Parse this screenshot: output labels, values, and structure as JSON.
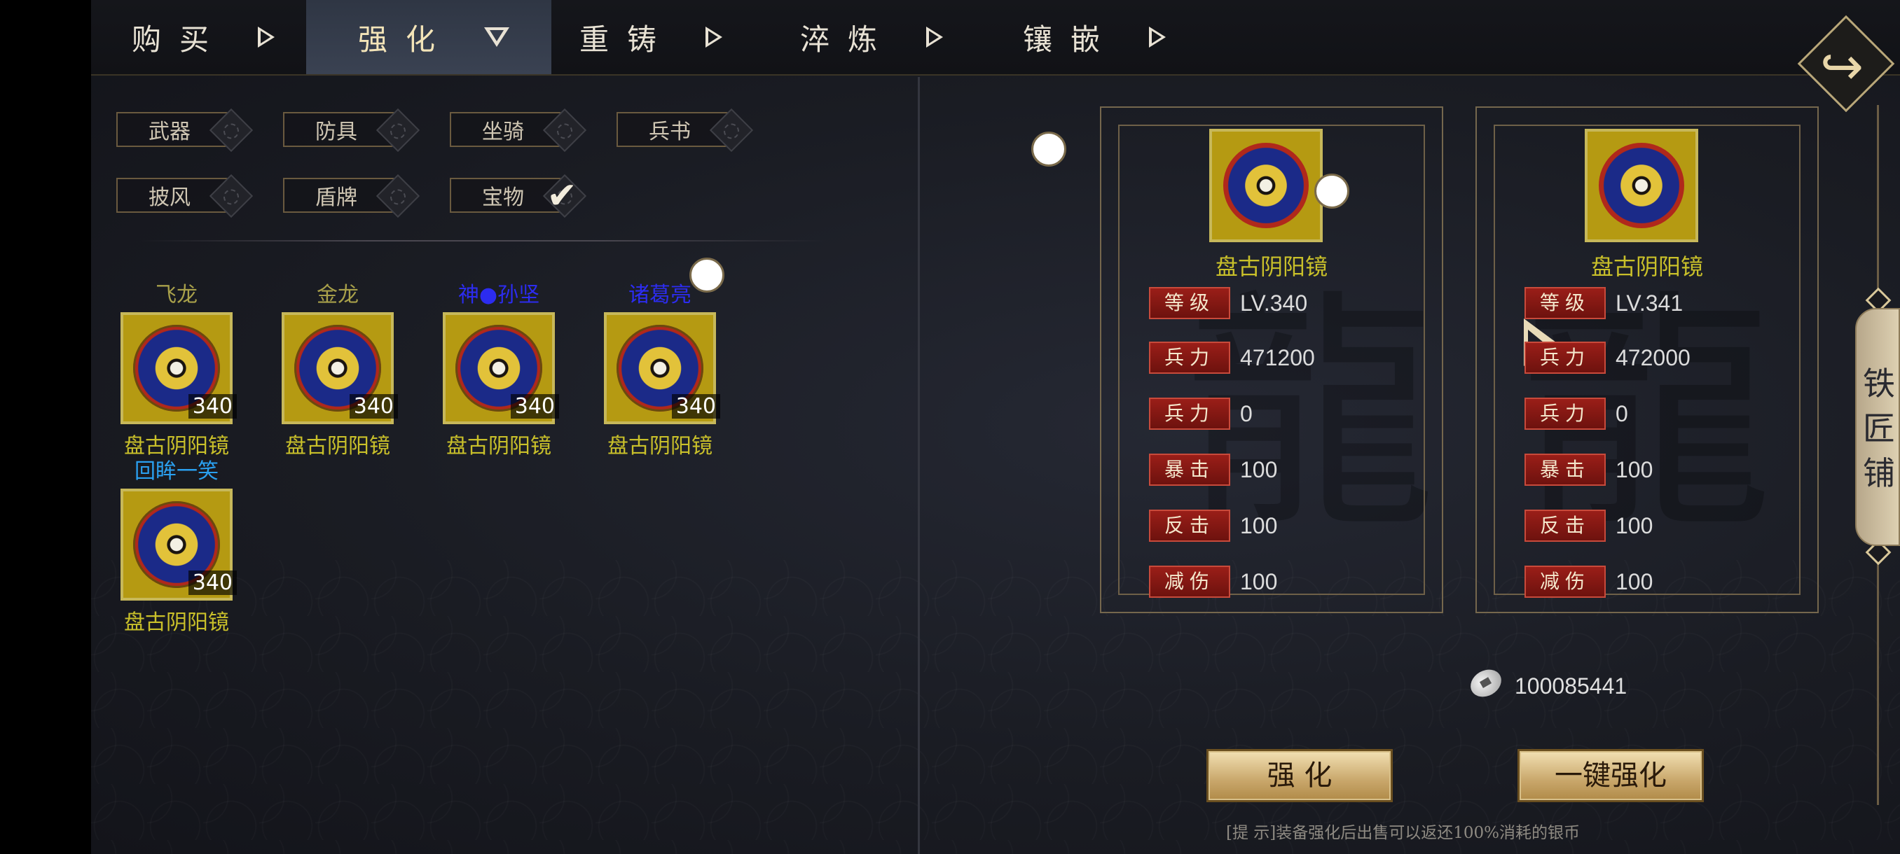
{
  "tabs": [
    {
      "label": "购买",
      "active": false
    },
    {
      "label": "强化",
      "active": true
    },
    {
      "label": "重铸",
      "active": false
    },
    {
      "label": "淬炼",
      "active": false
    },
    {
      "label": "镶嵌",
      "active": false
    }
  ],
  "categories": [
    {
      "label": "武器",
      "checked": false
    },
    {
      "label": "防具",
      "checked": false
    },
    {
      "label": "坐骑",
      "checked": false
    },
    {
      "label": "兵书",
      "checked": false
    },
    {
      "label": "披风",
      "checked": false
    },
    {
      "label": "盾牌",
      "checked": false
    },
    {
      "label": "宝物",
      "checked": true
    }
  ],
  "items": [
    {
      "owner": "飞龙",
      "owner_color": "#a8a04a",
      "level": "340",
      "name": "盘古阴阳镜"
    },
    {
      "owner": "金龙",
      "owner_color": "#a8a04a",
      "level": "340",
      "name": "盘古阴阳镜"
    },
    {
      "owner": "神●孙坚",
      "owner_color": "#2c2cf0",
      "level": "340",
      "name": "盘古阴阳镜"
    },
    {
      "owner": "诸葛亮",
      "owner_color": "#2c2cf0",
      "level": "340",
      "name": "盘古阴阳镜"
    },
    {
      "owner": "回眸一笑",
      "owner_color": "#2aa0f0",
      "level": "340",
      "name": "盘古阴阳镜"
    }
  ],
  "current": {
    "name": "盘古阴阳镜",
    "stats": [
      {
        "label": "等级",
        "value": "LV.340"
      },
      {
        "label": "兵力",
        "value": "471200"
      },
      {
        "label": "兵力",
        "value": "0"
      },
      {
        "label": "暴击",
        "value": "100"
      },
      {
        "label": "反击",
        "value": "100"
      },
      {
        "label": "减伤",
        "value": "100"
      }
    ]
  },
  "next": {
    "name": "盘古阴阳镜",
    "stats": [
      {
        "label": "等级",
        "value": "LV.341"
      },
      {
        "label": "兵力",
        "value": "472000"
      },
      {
        "label": "兵力",
        "value": "0"
      },
      {
        "label": "暴击",
        "value": "100"
      },
      {
        "label": "反击",
        "value": "100"
      },
      {
        "label": "减伤",
        "value": "100"
      }
    ]
  },
  "silver": "100085441",
  "buttons": {
    "enhance": "强 化",
    "one_click": "一键强化"
  },
  "tip": "[提 示]装备强化后出售可以返还100%消耗的银币",
  "side_tab": {
    "label": "铁匠铺"
  },
  "colors": {
    "accent_gold": "#c9c02a",
    "stat_red": "#9a1e18",
    "panel_bg": "#1a1c23"
  },
  "icons": {
    "back": "return-arrow-icon",
    "coin": "silver-coin-icon",
    "equipment": "yin-yang-mirror-icon"
  }
}
